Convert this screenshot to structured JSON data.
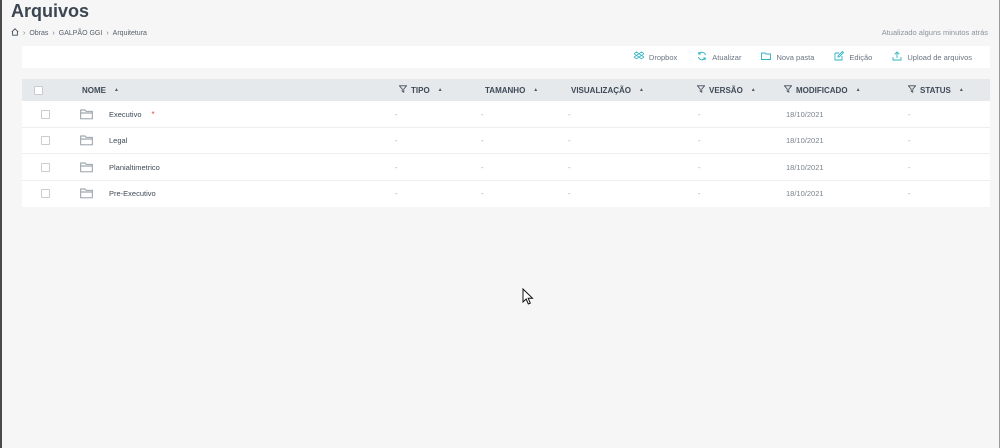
{
  "page": {
    "title": "Arquivos",
    "updated": "Atualizado alguns minutos atrás"
  },
  "breadcrumb": {
    "items": [
      "Obras",
      "GALPÃO GGI",
      "Arquitetura"
    ]
  },
  "toolbar": {
    "dropbox": "Dropbox",
    "atualizar": "Atualizar",
    "nova_pasta": "Nova pasta",
    "edicao": "Edição",
    "upload": "Upload de arquivos"
  },
  "table": {
    "columns": {
      "nome": "NOME",
      "tipo": "TIPO",
      "tamanho": "TAMANHO",
      "visualizacao": "VISUALIZAÇÃO",
      "versao": "VERSÃO",
      "modificado": "MODIFICADO",
      "status": "STATUS"
    },
    "rows": [
      {
        "name": "Executivo",
        "flag": "*",
        "tipo": "-",
        "tamanho": "-",
        "visualizacao": "-",
        "versao": "-",
        "modificado": "18/10/2021",
        "status": "-"
      },
      {
        "name": "Legal",
        "tipo": "-",
        "tamanho": "-",
        "visualizacao": "-",
        "versao": "-",
        "modificado": "18/10/2021",
        "status": "-"
      },
      {
        "name": "Planialtimetrico",
        "tipo": "-",
        "tamanho": "-",
        "visualizacao": "-",
        "versao": "-",
        "modificado": "18/10/2021",
        "status": "-"
      },
      {
        "name": "Pre-Executivo",
        "tipo": "-",
        "tamanho": "-",
        "visualizacao": "-",
        "versao": "-",
        "modificado": "18/10/2021",
        "status": "-"
      }
    ]
  },
  "colors": {
    "accent": "#2fb3c2",
    "header_bg": "#e6e9ec",
    "page_bg": "#f6f6f7",
    "flag": "#e04a4a"
  }
}
